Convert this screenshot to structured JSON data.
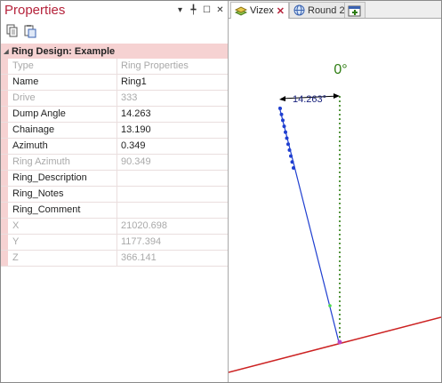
{
  "panel": {
    "title": "Properties",
    "title_buttons": {
      "dropdown": "▾",
      "pin": "╇",
      "maximize": "☐",
      "close": "✕"
    }
  },
  "grid": {
    "group_label": "Ring Design: Example",
    "rows": [
      {
        "name": "Type",
        "value": "Ring Properties",
        "dim": true
      },
      {
        "name": "Name",
        "value": "Ring1",
        "dim": false
      },
      {
        "name": "Drive",
        "value": "333",
        "dim": true
      },
      {
        "name": "Dump Angle",
        "value": "14.263",
        "dim": false
      },
      {
        "name": "Chainage",
        "value": "13.190",
        "dim": false
      },
      {
        "name": "Azimuth",
        "value": "0.349",
        "dim": false
      },
      {
        "name": "Ring Azimuth",
        "value": "90.349",
        "dim": true
      },
      {
        "name": "Ring_Description",
        "value": "",
        "dim": false
      },
      {
        "name": "Ring_Notes",
        "value": "",
        "dim": false
      },
      {
        "name": "Ring_Comment",
        "value": "",
        "dim": false
      },
      {
        "name": "X",
        "value": "21020.698",
        "dim": true
      },
      {
        "name": "Y",
        "value": "1177.394",
        "dim": true
      },
      {
        "name": "Z",
        "value": "366.141",
        "dim": true
      }
    ]
  },
  "tabs": [
    {
      "label": "Vizex",
      "active": true
    },
    {
      "label": "Round 2",
      "active": false
    }
  ],
  "view": {
    "vertical_label": "0°",
    "angle_label": "14.263°",
    "colors": {
      "vertical": "#2e7d12",
      "hole": "#1f3fd0",
      "ground": "#cc2222",
      "label_text": "#1a237e",
      "accent": "#b5233b"
    }
  }
}
